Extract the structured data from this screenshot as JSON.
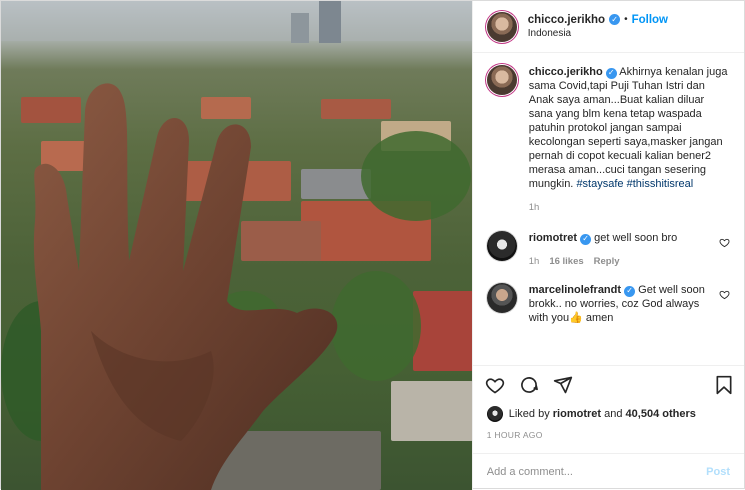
{
  "header": {
    "username": "chicco.jerikho",
    "dot": "•",
    "follow_label": "Follow",
    "location": "Indonesia"
  },
  "caption": {
    "username": "chicco.jerikho",
    "text": "Akhirnya kenalan juga sama Covid,tapi Puji Tuhan Istri dan Anak saya aman...Buat kalian diluar sana yang blm kena tetap waspada patuhin protokol jangan sampai kecolongan seperti saya,masker jangan pernah di copot kecuali kalian bener2 merasa aman...cuci tangan sesering mungkin.",
    "hashtag1": "#staysafe",
    "hashtag2": "#thisshitisreal",
    "time": "1h"
  },
  "comments": [
    {
      "username": "riomotret",
      "text": "get well soon bro",
      "time": "1h",
      "likes": "16 likes",
      "reply": "Reply"
    },
    {
      "username": "marcelinolefrandt",
      "text": "Get well soon brokk.. no worries, coz God always with you👍 amen"
    }
  ],
  "actions": {
    "icons": [
      "heart-icon",
      "comment-icon",
      "share-icon",
      "bookmark-icon"
    ]
  },
  "likes": {
    "prefix": "Liked by",
    "user": "riomotret",
    "and": "and",
    "others": "40,504 others"
  },
  "timestamp": "1 HOUR AGO",
  "add_comment": {
    "placeholder": "Add a comment...",
    "post_label": "Post"
  },
  "colors": {
    "accent": "#0095f6",
    "verified": "#3897f0",
    "muted": "#8e8e8e",
    "post_disabled": "#b2dffc"
  }
}
